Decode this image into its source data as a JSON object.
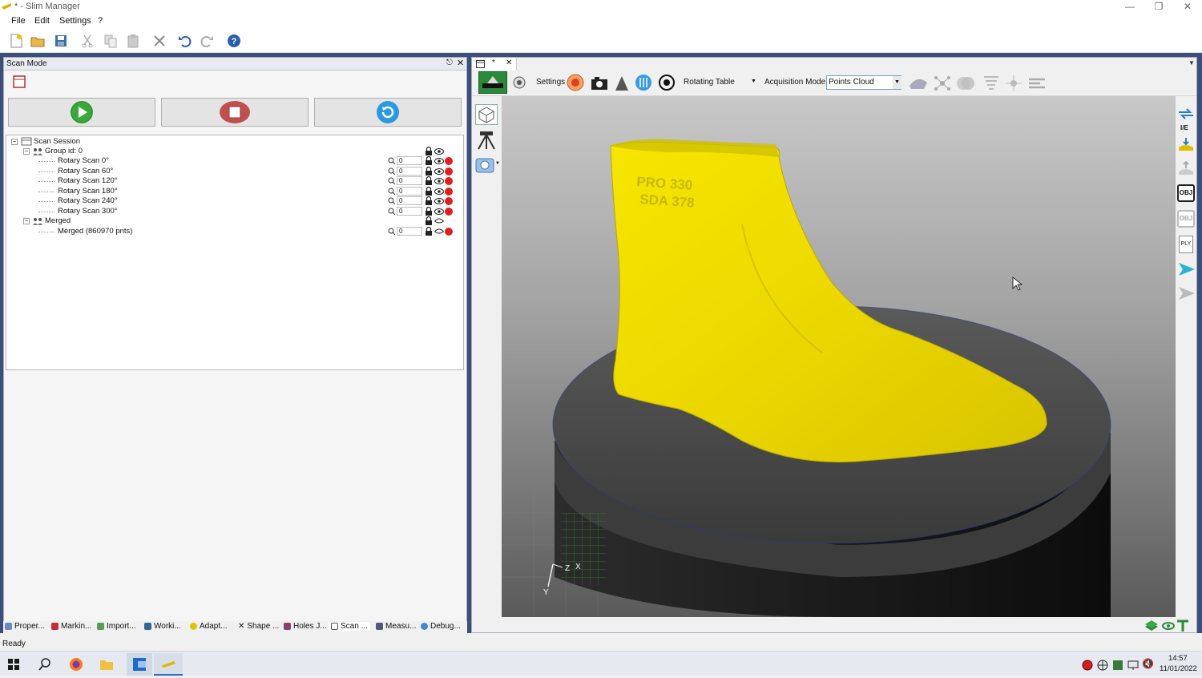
{
  "window": {
    "title": "* - Slim Manager"
  },
  "menu": {
    "file": "File",
    "edit": "Edit",
    "settings": "Settings",
    "help": "?"
  },
  "scan_panel": {
    "title": "Scan Mode",
    "tree": {
      "root": "Scan Session",
      "group": "Group id: 0",
      "scans": [
        {
          "label": "Rotary Scan 0°",
          "value": "0"
        },
        {
          "label": "Rotary Scan 60°",
          "value": "0"
        },
        {
          "label": "Rotary Scan 120°",
          "value": "0"
        },
        {
          "label": "Rotary Scan 180°",
          "value": "0"
        },
        {
          "label": "Rotary Scan 240°",
          "value": "0"
        },
        {
          "label": "Rotary Scan 300°",
          "value": "0"
        }
      ],
      "merged_group": "Merged",
      "merged_item": {
        "label": "Merged (860970 pnts)",
        "value": "0"
      }
    }
  },
  "bottom_tabs": [
    "Proper...",
    "Markin...",
    "Import...",
    "Worki...",
    "Adapt...",
    "Shape ...",
    "Holes J...",
    "Scan ...",
    "Measu...",
    "Debug..."
  ],
  "view_toolbar": {
    "settings_label": "Settings",
    "device_select": "Rotating Table",
    "acq_label": "Acquisition Mode",
    "acq_value": "Points Cloud"
  },
  "doc_tab": {
    "title": "*"
  },
  "viewport": {
    "axes": {
      "x": "X",
      "y": "Y",
      "z": "Z"
    },
    "emboss_line1": "PRO 330",
    "emboss_line2": "SDA 378",
    "object_color": "#f2e000",
    "table_color": "#3a3a3a"
  },
  "right_tools": {
    "ie_label": "I/E",
    "obj_label": "OBJ",
    "ply_label": "PLY"
  },
  "status": {
    "text": "Ready"
  },
  "taskbar": {
    "time": "14:57",
    "date": "11/01/2022"
  }
}
